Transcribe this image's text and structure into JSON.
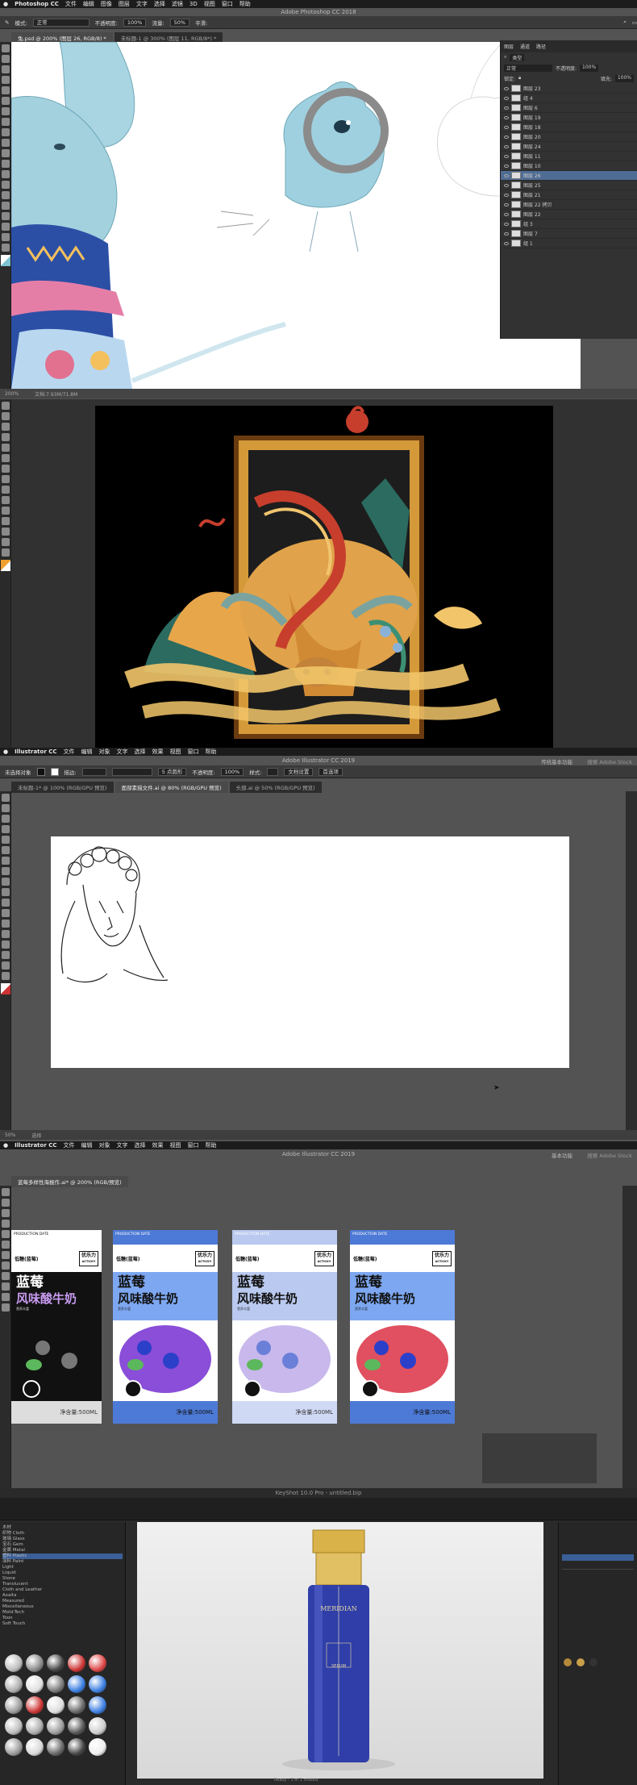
{
  "ps": {
    "menubar": {
      "app": "Photoshop CC",
      "items": [
        "文件",
        "编辑",
        "图像",
        "图层",
        "文字",
        "选择",
        "滤镜",
        "3D",
        "视图",
        "窗口",
        "帮助"
      ]
    },
    "title": "Adobe Photoshop CC 2018",
    "options": {
      "mode_label": "模式:",
      "mode_value": "正常",
      "opacity_label": "不透明度:",
      "opacity_value": "100%",
      "flow_label": "流量:",
      "flow_value": "50%",
      "smooth_label": "平滑:"
    },
    "tabs": [
      "兔.psd @ 200% (图层 26, RGB/8) *",
      "未标题-1 @ 300% (图层 11, RGB/8*) *"
    ],
    "layers_panel": {
      "tabs": [
        "图层",
        "通道",
        "路径"
      ],
      "kind": "类型",
      "blend": "正常",
      "opacity_label": "不透明度:",
      "opacity": "100%",
      "lock_label": "锁定:",
      "fill_label": "填充:",
      "fill": "100%",
      "layers": [
        "图层 23",
        "组 4",
        "图层 6",
        "图层 19",
        "图层 18",
        "图层 20",
        "图层 24",
        "图层 11",
        "图层 10",
        "图层 26",
        "图层 25",
        "图层 21",
        "图层 22 拷贝",
        "图层 22",
        "组 3",
        "图层 7",
        "组 1"
      ]
    },
    "status": {
      "zoom": "200%",
      "doc": "文档:7.93M/71.8M"
    }
  },
  "ai1": {
    "menubar": {
      "app": "Illustrator CC",
      "items": [
        "文件",
        "编辑",
        "对象",
        "文字",
        "选择",
        "效果",
        "视图",
        "窗口",
        "帮助"
      ]
    },
    "title": "Adobe Illustrator CC 2019",
    "options": {
      "state": "未选择对象",
      "stroke_label": "描边:",
      "brush": "5 点圆形",
      "opacity_label": "不透明度:",
      "opacity": "100%",
      "style_label": "样式:",
      "doc_setup": "文档设置",
      "prefs": "首选项"
    },
    "workspace": "传统基本功能",
    "search": "搜索 Adobe Stock",
    "tabs": [
      "未标题-1* @ 100% (RGB/GPU 预览)",
      "面部素描文件.ai @ 80% (RGB/GPU 预览)",
      "头部.ai @ 50% (RGB/GPU 预览)"
    ],
    "status": {
      "zoom": "50%",
      "tool": "选择"
    }
  },
  "ai2": {
    "menubar": {
      "app": "Illustrator CC",
      "items": [
        "文件",
        "编辑",
        "对象",
        "文字",
        "选择",
        "效果",
        "视图",
        "窗口",
        "帮助"
      ]
    },
    "title": "Adobe Illustrator CC 2019",
    "workspace": "基本功能",
    "search": "搜索 Adobe Stock",
    "tab": "蓝莓多样性海报作.ai* @ 200% (RGB/预览)",
    "packages": [
      {
        "top": "PRODUCTION DATE",
        "brand1": "蓝莓",
        "brand2": "风味酸牛奶",
        "sub": "低糖(蓝莓)",
        "tag": "营养丰富",
        "net": "净含量:500ML",
        "corner": "优乐力",
        "corner_en": "ACTICKY"
      },
      {
        "top": "PRODUCTION DATE",
        "brand1": "蓝莓",
        "brand2": "风味酸牛奶",
        "sub": "低糖(蓝莓)",
        "tag": "营养丰富",
        "net": "净含量:500ML",
        "corner": "优乐力",
        "corner_en": "ACTICKY"
      },
      {
        "top": "PRODUCTION DATE",
        "brand1": "蓝莓",
        "brand2": "风味酸牛奶",
        "sub": "低糖(蓝莓)",
        "tag": "营养丰富",
        "net": "净含量:500ML",
        "corner": "优乐力",
        "corner_en": "ACTICKY"
      },
      {
        "top": "PRODUCTION DATE",
        "brand1": "蓝莓",
        "brand2": "风味酸牛奶",
        "sub": "低糖(蓝莓)",
        "tag": "营养丰富",
        "net": "净含量:500ML",
        "corner": "优乐力",
        "corner_en": "ACTICKY"
      }
    ]
  },
  "ks": {
    "title": "KeyShot 10.0 Pro - untitled.bip",
    "library_items": [
      "木材",
      "织物 Cloth",
      "玻璃 Glass",
      "宝石 Gem",
      "金属 Metal",
      "塑料 Plastic",
      "涂料 Paint",
      "Light",
      "Liquid",
      "Stone",
      "Translucent",
      "Cloth and Leather",
      "Axalta",
      "Measured",
      "Miscellaneous",
      "Mold-Tech",
      "Toon",
      "Soft Touch"
    ],
    "bottle": {
      "brand": "MERIDIAN",
      "label": "SERUM"
    },
    "bottom": "Ready - 1 of 1 models"
  },
  "colors": {
    "accent": "#4d7ad6",
    "ps_bg": "#535353",
    "ai_bg": "#535353"
  }
}
